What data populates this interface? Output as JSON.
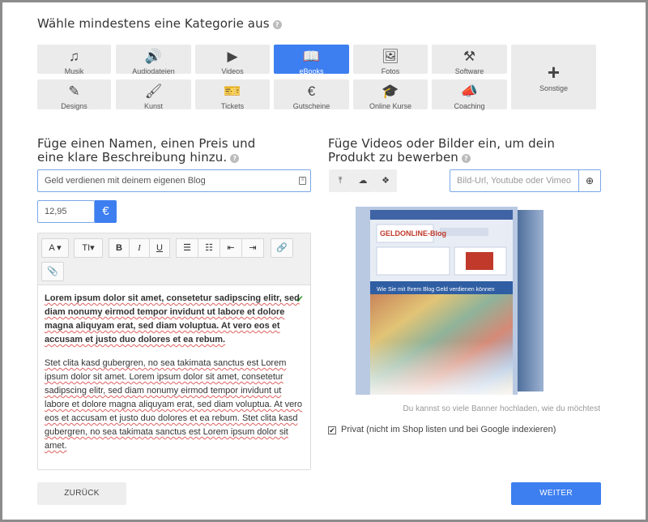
{
  "heading_category": "Wähle mindestens eine Kategorie aus",
  "help_glyph": "?",
  "categories": [
    {
      "label": "Musik",
      "icon": "music-note-icon",
      "glyph": "♫",
      "active": false
    },
    {
      "label": "Audiodateien",
      "icon": "speaker-icon",
      "glyph": "🔊",
      "active": false
    },
    {
      "label": "Videos",
      "icon": "play-icon",
      "glyph": "▶",
      "active": false
    },
    {
      "label": "eBooks",
      "icon": "book-icon",
      "glyph": "📖",
      "active": true
    },
    {
      "label": "Fotos",
      "icon": "image-icon",
      "glyph": "🖼",
      "active": false
    },
    {
      "label": "Software",
      "icon": "tools-icon",
      "glyph": "⚒",
      "active": false
    },
    {
      "label": "Designs",
      "icon": "design-icon",
      "glyph": "✎",
      "active": false
    },
    {
      "label": "Kunst",
      "icon": "brush-icon",
      "glyph": "🖌",
      "active": false
    },
    {
      "label": "Tickets",
      "icon": "ticket-icon",
      "glyph": "🎫",
      "active": false
    },
    {
      "label": "Gutscheine",
      "icon": "voucher-icon",
      "glyph": "€",
      "active": false
    },
    {
      "label": "Online Kurse",
      "icon": "graduation-cap-icon",
      "glyph": "🎓",
      "active": false
    },
    {
      "label": "Coaching",
      "icon": "whistle-icon",
      "glyph": "📣",
      "active": false
    },
    {
      "label": "Sonstige",
      "icon": "plus-icon",
      "glyph": "+",
      "active": false
    }
  ],
  "heading_name": "Füge einen Namen, einen Preis und eine klare Beschreibung hinzu.",
  "heading_media": "Füge Videos oder Bilder ein, um dein Produkt zu bewerben",
  "product_name": "Geld verdienen mit deinem eigenen Blog",
  "price": "12,95",
  "currency": "€",
  "toolbar": {
    "font": "A",
    "size": "TI",
    "bold": "B",
    "italic": "I",
    "underline": "U"
  },
  "description_bold": "Lorem ipsum dolor sit amet, consetetur sadipscing elitr, sed diam nonumy eirmod tempor invidunt ut labore et dolore magna aliquyam erat, sed diam voluptua. At vero eos et accusam et justo duo dolores et ea rebum.",
  "description_text": "Stet clita kasd gubergren, no sea takimata sanctus est Lorem ipsum dolor sit amet. Lorem ipsum dolor sit amet, consetetur sadipscing elitr, sed diam nonumy eirmod tempor invidunt ut labore et dolore magna aliquyam erat, sed diam voluptua. At vero eos et accusam et justo duo dolores et ea rebum. Stet clita kasd gubergren, no sea takimata sanctus est Lorem ipsum dolor sit amet.",
  "url_placeholder": "Bild-Url, Youtube oder Vimeo",
  "book_cover": {
    "logo": "GELDONLINE-Blog",
    "banner": "Wie Sie mit Ihrem Blog Geld verdienen können"
  },
  "upload_note": "Du kannst so viele Banner hochladen, wie du möchtest",
  "private_label": "Privat (nicht im Shop listen und bei Google indexieren)",
  "back_button": "ZURÜCK",
  "next_button": "WEITER",
  "colors": {
    "accent": "#3d7ff0",
    "tile": "#ebebeb",
    "valid": "#3a9a3a"
  }
}
